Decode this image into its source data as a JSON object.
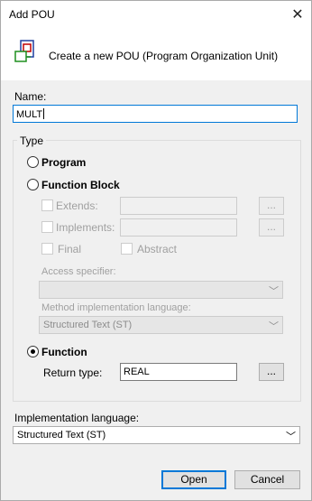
{
  "window": {
    "title": "Add POU"
  },
  "header": {
    "text": "Create a new POU (Program Organization Unit)"
  },
  "name": {
    "label": "Name:",
    "value": "MULT"
  },
  "type_group": {
    "title": "Type",
    "program_label": "Program",
    "function_block_label": "Function Block",
    "extends_label": "Extends:",
    "implements_label": "Implements:",
    "final_label": "Final",
    "abstract_label": "Abstract",
    "access_label": "Access specifier:",
    "method_lang_label": "Method implementation language:",
    "method_lang_value": "Structured Text (ST)",
    "function_label": "Function",
    "return_type_label": "Return type:",
    "return_type_value": "REAL",
    "browse_label": "..."
  },
  "impl": {
    "label": "Implementation language:",
    "value": "Structured Text (ST)"
  },
  "buttons": {
    "open": "Open",
    "cancel": "Cancel"
  },
  "icons": {
    "close": "close-icon",
    "pou": "pou-icon",
    "dropdown": "chevron-down-icon"
  }
}
